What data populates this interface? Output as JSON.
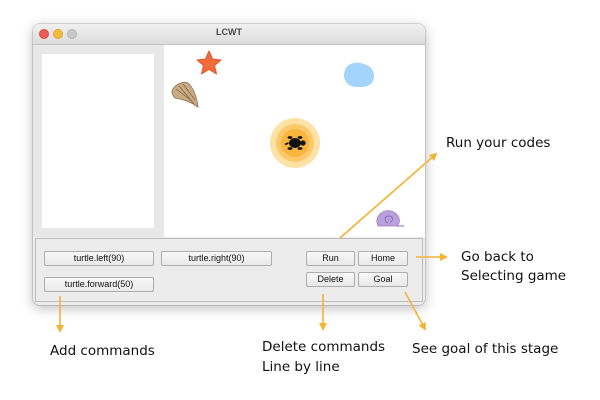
{
  "window": {
    "title": "LCWT"
  },
  "commands": {
    "left_label": "turtle.left(90)",
    "right_label": "turtle.right(90)",
    "forward_label": "turtle.forward(50)"
  },
  "controls": {
    "run_label": "Run",
    "home_label": "Home",
    "delete_label": "Delete",
    "goal_label": "Goal"
  },
  "annotations": {
    "run": "Run your codes",
    "home_line1": "Go back to",
    "home_line2": "Selecting game",
    "add": "Add commands",
    "delete_line1": "Delete commands",
    "delete_line2": "Line by line",
    "goal": "See goal of this stage"
  },
  "colors": {
    "arrow": "#f5b335",
    "goal_ring": "#fbd88d",
    "target_circle": "#a4d4fb",
    "starfish": "#f26b3a",
    "snail": "#b9a0dd"
  },
  "icons": [
    "starfish-icon",
    "seashell-icon",
    "target-circle-icon",
    "turtle-icon",
    "snail-shell-icon"
  ]
}
